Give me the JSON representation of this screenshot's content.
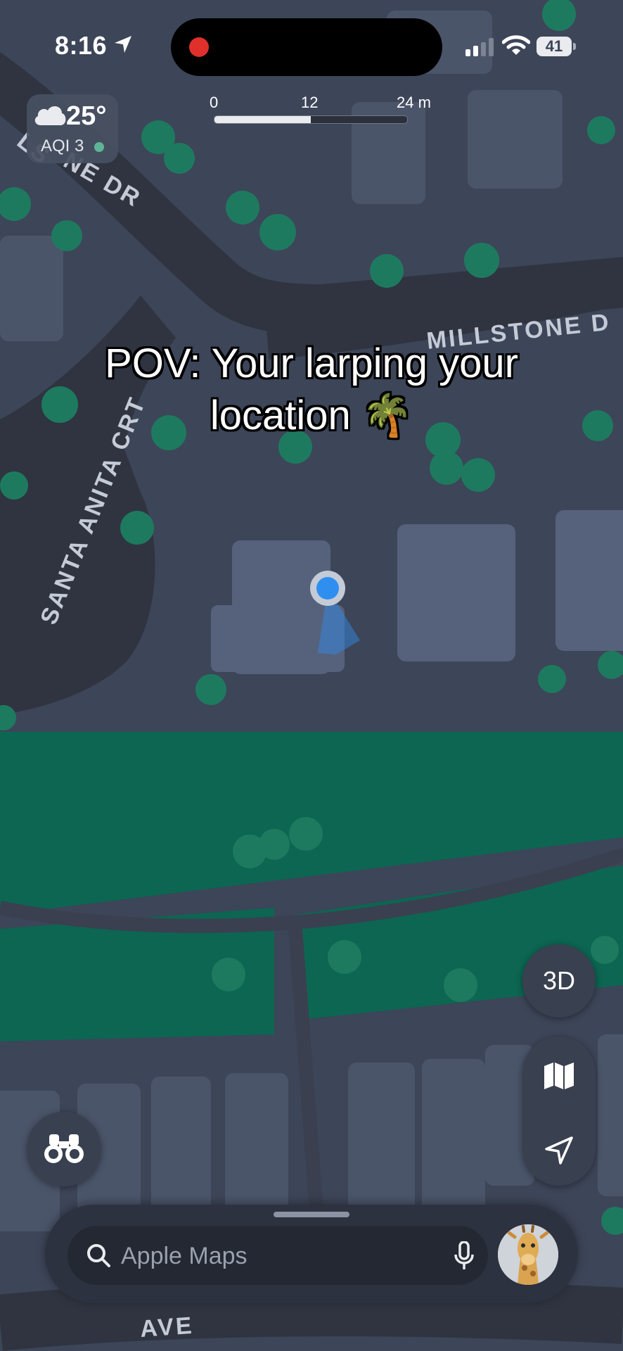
{
  "status_bar": {
    "time": "8:16",
    "battery_level": "41",
    "recording": true
  },
  "weather": {
    "temperature": "25°",
    "aqi_label": "AQI 3",
    "condition_icon": "cloud-icon",
    "aqi_color": "#5db596"
  },
  "scale": {
    "labels": [
      "0",
      "12",
      "24 m"
    ]
  },
  "map": {
    "streets": [
      "LS",
      "NE DR",
      "MILLSTONE D",
      "SANTA ANITA CRT",
      "AVE"
    ],
    "user_location_color": "#2f8ff0",
    "park_color": "#0c6652",
    "road_color": "#2f3440",
    "building_color": "#56627c"
  },
  "caption": {
    "line1": "POV: Your larping your",
    "line2": "location 🌴"
  },
  "controls": {
    "three_d_label": "3D",
    "map_mode_icon": "map-icon",
    "locate_icon": "location-arrow-icon",
    "look_around_icon": "binoculars-icon"
  },
  "search": {
    "placeholder": "Apple Maps",
    "mic_icon": "microphone-icon"
  },
  "colors": {
    "accent_blue": "#2f8ff0",
    "recording_red": "#e0302b"
  }
}
